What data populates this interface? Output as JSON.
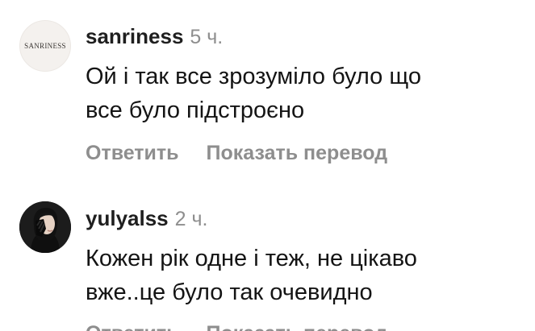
{
  "comments": [
    {
      "username": "sanriness",
      "time": "5 ч.",
      "avatar_text": "SANRINESS",
      "text_line1": "Ой і так все зрозуміло було що",
      "text_line2": "все було підстроєно",
      "reply_label": "Ответить",
      "translate_label": "Показать перевод"
    },
    {
      "username": "yulyalss",
      "time": "2 ч.",
      "text_line1": "Кожен рік одне і теж, не цікаво",
      "text_line2": "вже..це було так очевидно",
      "reply_label": "Ответить",
      "translate_label": "Показать перевод"
    }
  ]
}
